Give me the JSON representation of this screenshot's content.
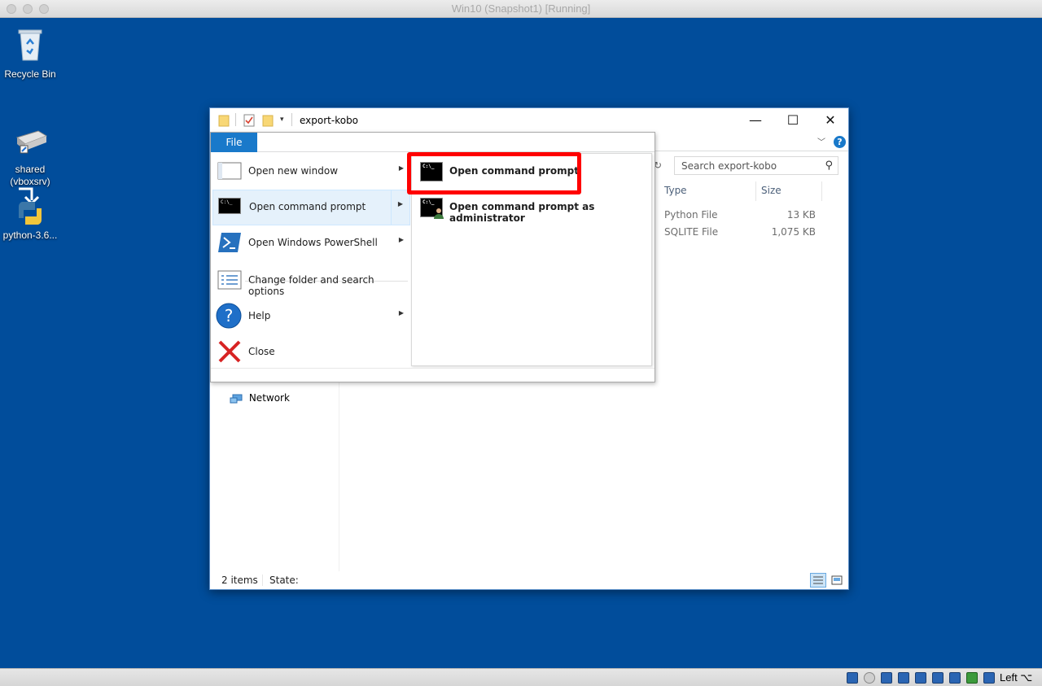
{
  "vm_window": {
    "title": "Win10 (Snapshot1) [Running]"
  },
  "desktop_icons": [
    {
      "label": "Recycle Bin"
    },
    {
      "label": "shared\n(vboxsrv)"
    },
    {
      "label": "python-3.6..."
    }
  ],
  "explorer": {
    "title": "export-kobo",
    "search_placeholder": "Search export-kobo",
    "columns": {
      "type": "Type",
      "size": "Size"
    },
    "rows": [
      {
        "type": "Python File",
        "size": "13 KB"
      },
      {
        "type": "SQLITE File",
        "size": "1,075 KB"
      }
    ],
    "nav": {
      "network": "Network"
    },
    "status": {
      "items": "2 items",
      "state": "State:"
    },
    "accent_color": "#1979ca"
  },
  "file_menu": {
    "tab_label": "File",
    "items": [
      {
        "label": "Open new window",
        "has_submenu": true
      },
      {
        "label": "Open command prompt",
        "has_submenu": true,
        "active": true
      },
      {
        "label": "Open Windows PowerShell",
        "has_submenu": true
      },
      {
        "label": "Change folder and search options",
        "has_submenu": false
      },
      {
        "label": "Help",
        "has_submenu": true
      },
      {
        "label": "Close",
        "has_submenu": false
      }
    ],
    "submenu": [
      {
        "label": "Open command prompt",
        "highlighted": true
      },
      {
        "label": "Open command prompt as administrator"
      }
    ]
  },
  "host_statusbar": {
    "host_key": "Left ⌥"
  },
  "colors": {
    "desktop": "#014d9b",
    "highlight_box": "#ff0000"
  }
}
